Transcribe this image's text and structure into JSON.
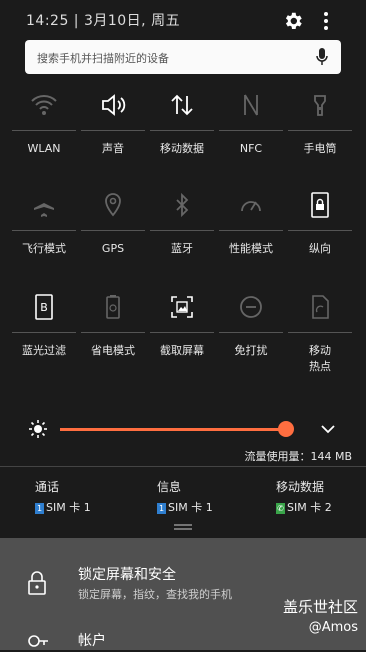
{
  "status": {
    "time_date": "14:25 | 3月10日, 周五"
  },
  "search": {
    "placeholder": "搜索手机并扫描附近的设备"
  },
  "tiles": [
    {
      "label": "WLAN",
      "icon": "wifi-icon"
    },
    {
      "label": "声音",
      "icon": "sound-icon"
    },
    {
      "label": "移动数据",
      "icon": "mobile-data-icon"
    },
    {
      "label": "NFC",
      "icon": "nfc-icon"
    },
    {
      "label": "手电筒",
      "icon": "flashlight-icon"
    },
    {
      "label": "飞行模式",
      "icon": "airplane-icon"
    },
    {
      "label": "GPS",
      "icon": "location-icon"
    },
    {
      "label": "蓝牙",
      "icon": "bluetooth-icon"
    },
    {
      "label": "性能模式",
      "icon": "performance-icon"
    },
    {
      "label": "纵向",
      "icon": "portrait-lock-icon"
    },
    {
      "label": "蓝光过滤",
      "icon": "blue-light-icon"
    },
    {
      "label": "省电模式",
      "icon": "power-saving-icon"
    },
    {
      "label": "截取屏幕",
      "icon": "screenshot-icon"
    },
    {
      "label": "免打扰",
      "icon": "do-not-disturb-icon"
    },
    {
      "label": "移动\n热点",
      "icon": "hotspot-icon"
    }
  ],
  "brightness": {
    "level": 0.92
  },
  "data_usage": "流量使用量：144 MB",
  "sim": [
    {
      "name": "通话",
      "badge": "1",
      "sim": "SIM 卡 1",
      "badge_color": "#2f7fd0"
    },
    {
      "name": "信息",
      "badge": "1",
      "sim": "SIM 卡 1",
      "badge_color": "#2f7fd0"
    },
    {
      "name": "移动数据",
      "badge": "📞",
      "sim": "SIM 卡 2",
      "badge_color": "#3aa54a"
    }
  ],
  "settings_item": {
    "title": "锁定屏幕和安全",
    "subtitle": "锁定屏幕，指纹，查找我的手机"
  },
  "account_item": {
    "title": "帐户"
  },
  "watermark": {
    "line1": "盖乐世社区",
    "line2": "@Amos"
  },
  "colors": {
    "accent": "#ff6e40"
  }
}
